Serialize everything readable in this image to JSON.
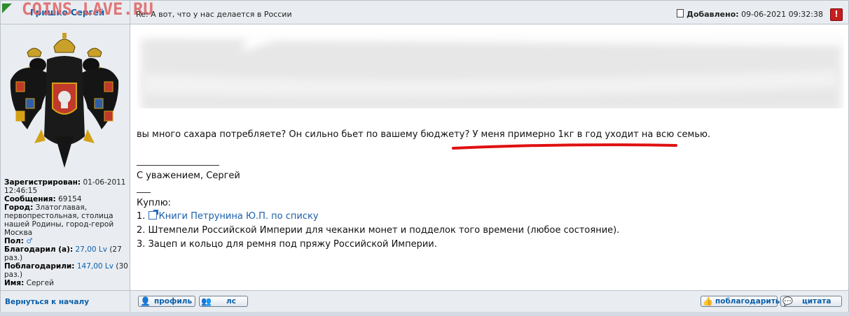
{
  "watermark": "COINS.LAVE.RU",
  "header": {
    "author": "Гришко Сергей",
    "subject": "Re: А вот, что у нас делается в России",
    "added_label": "Добавлено:",
    "added_value": "09-06-2021 09:32:38",
    "report_label": "!"
  },
  "sidebar": {
    "registered_label": "Зарегистрирован:",
    "registered_value": "01-06-2011 12:46:15",
    "messages_label": "Сообщения:",
    "messages_value": "69154",
    "city_label": "Город:",
    "city_value": "Златоглавая, первопрестольная, столица нашей Родины, город-герой Москва",
    "gender_label": "Пол:",
    "gender_icon": "male-icon",
    "thanked_label": "Благодарил (а):",
    "thanked_value": "27,00 Lv",
    "thanked_count": "(27 раз.)",
    "was_thanked_label": "Поблагодарили:",
    "was_thanked_value": "147,00 Lv",
    "was_thanked_count": "(30 раз.)",
    "name_label": "Имя:",
    "name_value": "Сергей"
  },
  "post": {
    "question": "вы много сахара потребляете? Он сильно бьет по вашему бюджету?",
    "answer": "У меня примерно 1кг в год уходит на всю семью.",
    "regards": "С уважением, Сергей",
    "buy_label": "Куплю:",
    "items": [
      {
        "num": "1.",
        "text": "Книги Петрунина Ю.П. по списку"
      },
      {
        "num": "2.",
        "text": "Штемпели Российской Империи для чеканки монет и подделок того времени (любое состояние)."
      },
      {
        "num": "3.",
        "text": "Зацеп и кольцо для ремня под пряжу Российской Империи."
      }
    ]
  },
  "footer": {
    "back_label": "Вернуться к началу",
    "profile_label": "профиль",
    "pm_label": "лс",
    "thank_label": "поблагодарить",
    "quote_label": "цитата"
  },
  "colors": {
    "header_bg": "#e9edf1",
    "link": "#0b5ea8",
    "underline": "#e01010"
  }
}
